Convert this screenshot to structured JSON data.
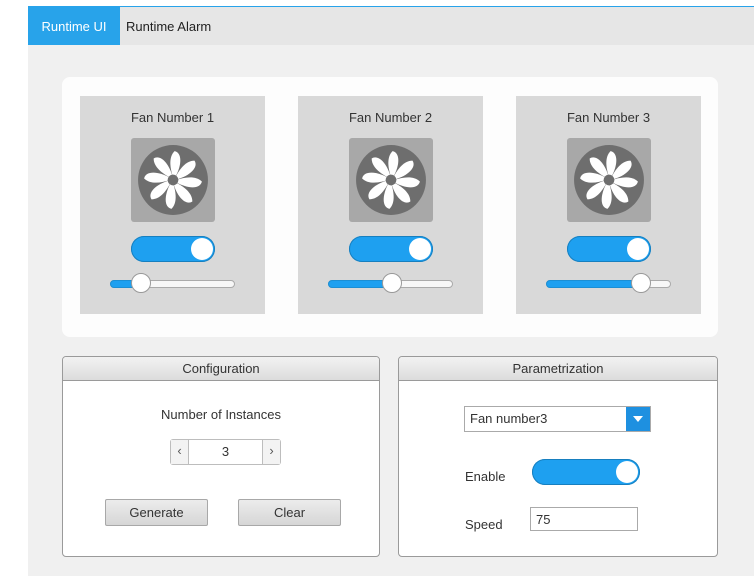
{
  "tabs": [
    {
      "label": "Runtime UI",
      "active": true
    },
    {
      "label": "Runtime Alarm",
      "active": false
    }
  ],
  "fans": [
    {
      "title": "Fan Number 1",
      "icon": "fan-icon",
      "enabled": true,
      "speed_fraction": 0.24
    },
    {
      "title": "Fan Number 2",
      "icon": "fan-icon",
      "enabled": true,
      "speed_fraction": 0.5
    },
    {
      "title": "Fan Number 3",
      "icon": "fan-icon",
      "enabled": true,
      "speed_fraction": 0.75
    }
  ],
  "configuration": {
    "title": "Configuration",
    "instances_label": "Number of Instances",
    "instances_value": "3",
    "decrement_glyph": "‹",
    "increment_glyph": "›",
    "generate_label": "Generate",
    "clear_label": "Clear"
  },
  "parametrization": {
    "title": "Parametrization",
    "selected_fan": "Fan number3",
    "enable_label": "Enable",
    "enable_value": true,
    "speed_label": "Speed",
    "speed_value": "75"
  },
  "colors": {
    "accent": "#28a3ea",
    "toggle_on": "#1ea0f0",
    "fan_tile": "#a8a8a8",
    "card_bg": "#d9d9d9"
  }
}
